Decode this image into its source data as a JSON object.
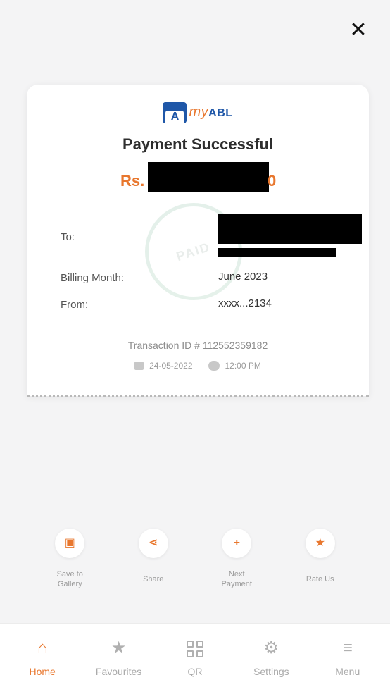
{
  "header": {
    "close_glyph": "✕"
  },
  "receipt": {
    "logo": {
      "my": "my",
      "brand": "ABL",
      "badge": "A"
    },
    "title": "Payment Successful",
    "amount_prefix": "Rs.",
    "amount_suffix": "0",
    "stamp_text": "PAID",
    "rows": [
      {
        "label": "To:",
        "value": ""
      },
      {
        "label": "Billing Month:",
        "value": "June 2023"
      },
      {
        "label": "From:",
        "value": "xxxx...2134"
      }
    ],
    "transaction_id": "Transaction ID # 112552359182",
    "date": "24-05-2022",
    "time": "12:00 PM"
  },
  "actions": [
    {
      "label": "Save to\nGallery",
      "icon": "image-icon",
      "glyph": "▣"
    },
    {
      "label": "Share",
      "icon": "share-icon",
      "glyph": "⋖"
    },
    {
      "label": "Next\nPayment",
      "icon": "plus-icon",
      "glyph": "+"
    },
    {
      "label": "Rate Us",
      "icon": "star-icon",
      "glyph": "★"
    }
  ],
  "nav": [
    {
      "label": "Home",
      "icon": "home-icon",
      "glyph": "⌂",
      "active": true
    },
    {
      "label": "Favourites",
      "icon": "star-icon",
      "glyph": "★",
      "active": false
    },
    {
      "label": "QR",
      "icon": "qr-icon",
      "glyph": "",
      "active": false
    },
    {
      "label": "Settings",
      "icon": "gear-icon",
      "glyph": "⚙",
      "active": false
    },
    {
      "label": "Menu",
      "icon": "menu-icon",
      "glyph": "≡",
      "active": false
    }
  ],
  "colors": {
    "accent": "#e8772e",
    "brand_blue": "#1f57a8",
    "background": "#f4f4f5"
  }
}
